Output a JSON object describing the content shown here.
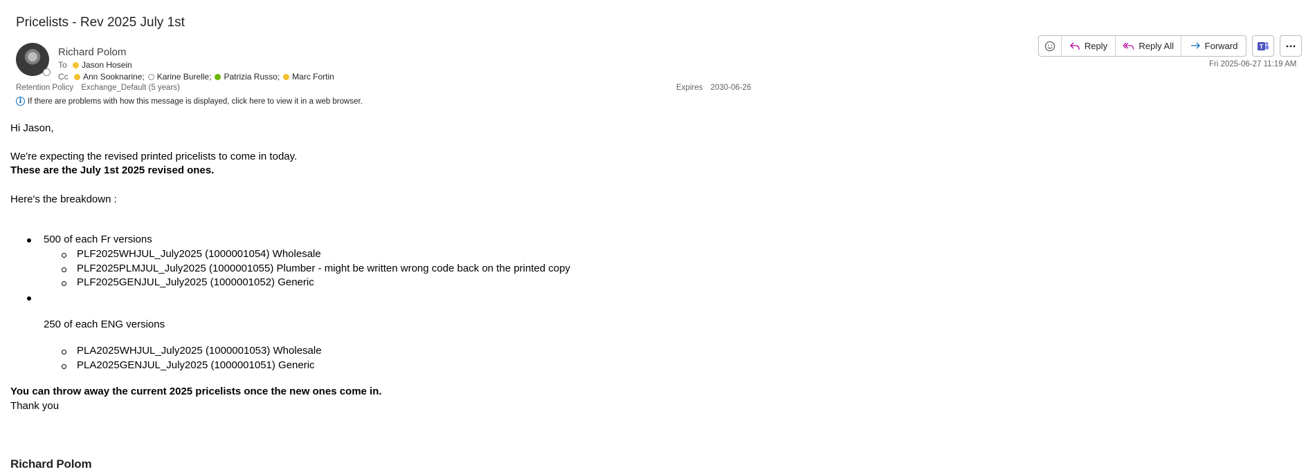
{
  "subject": "Pricelists - Rev 2025 July 1st",
  "sender": {
    "name": "Richard Polom",
    "presence": "offline"
  },
  "to_label": "To",
  "to": [
    {
      "name": "Jason Hosein",
      "status": "away"
    }
  ],
  "cc_label": "Cc",
  "cc": [
    {
      "name": "Ann Sooknarine;",
      "status": "away"
    },
    {
      "name": "Karine Burelle;",
      "status": "offline"
    },
    {
      "name": "Patrizia Russo;",
      "status": "available"
    },
    {
      "name": "Marc Fortin",
      "status": "away"
    }
  ],
  "retention": {
    "label": "Retention Policy",
    "value": "Exchange_Default (5 years)"
  },
  "expires": {
    "label": "Expires",
    "value": "2030-06-26"
  },
  "info_banner": "If there are problems with how this message is displayed, click here to view it in a web browser.",
  "toolbar": {
    "reply": "Reply",
    "reply_all": "Reply All",
    "forward": "Forward"
  },
  "date": "Fri 2025-06-27 11:19 AM",
  "body": {
    "greeting": "Hi Jason,",
    "line1": "We're expecting the revised printed pricelists to come in today.",
    "line2": "These are the July 1st 2025 revised ones.",
    "line3": "Here's the breakdown :",
    "fr_heading": "500 of each Fr versions",
    "fr_items": [
      "PLF2025WHJUL_July2025 (1000001054) Wholesale",
      "PLF2025PLMJUL_July2025 (1000001055) Plumber - might be written wrong code back on the printed copy",
      "PLF2025GENJUL_July2025 (1000001052) Generic"
    ],
    "eng_heading": "250 of each ENG versions",
    "eng_items": [
      "PLA2025WHJUL_July2025 (1000001053)  Wholesale",
      "PLA2025GENJUL_July2025 (1000001051) Generic"
    ],
    "closing_bold": "You can throw away the current 2025 pricelists once the new ones come in.",
    "thanks": "Thank you"
  },
  "signature": "Richard Polom",
  "colors": {
    "away": "#f2c12e",
    "available": "#6bb700",
    "accent": "#0f6cbd",
    "reply_all_accent": "#b4009e",
    "teams": "#4b53bc"
  }
}
